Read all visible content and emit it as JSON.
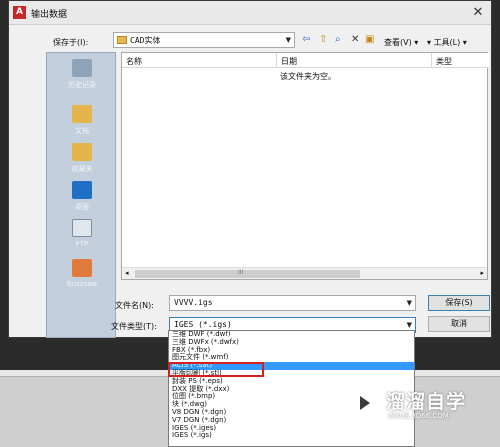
{
  "window": {
    "title": "输出数据",
    "app_icon_letter": "A",
    "close_glyph": "✕"
  },
  "save_in": {
    "label": "保存于(I):",
    "value": "CAD实体"
  },
  "toolbar": {
    "back_glyph": "⇦",
    "up_glyph": "⇧",
    "search_glyph": "⌕",
    "delete_glyph": "✕",
    "newfolder_glyph": "▣",
    "view_label": "查看(V)",
    "tools_label": "工具(L)"
  },
  "places": [
    {
      "name": "history",
      "label": "历史记录",
      "color": "#8ea2b8"
    },
    {
      "name": "documents",
      "label": "文档",
      "color": "#e3b54a"
    },
    {
      "name": "favorites",
      "label": "收藏夹",
      "color": "#e3b54a"
    },
    {
      "name": "desktop",
      "label": "桌面",
      "color": "#1f6fc4"
    },
    {
      "name": "ftp",
      "label": "FTP",
      "color": "#dfe6ee"
    },
    {
      "name": "buzzsaw",
      "label": "Buzzsaw",
      "color": "#e07a3a"
    }
  ],
  "filelist": {
    "col_name": "名称",
    "col_date": "日期",
    "col_type": "类型",
    "empty_text": "该文件夹为空。",
    "scroll_mark": "III"
  },
  "filename": {
    "label": "文件名(N):",
    "value": "VVVV.igs"
  },
  "filetype": {
    "label": "文件类型(T):",
    "value": "IGES (*.igs)"
  },
  "buttons": {
    "save": "保存(S)",
    "cancel": "取消"
  },
  "dropdown_options": [
    "三维 DWF (*.dwf)",
    "三维 DWFx (*.dwfx)",
    "FBX (*.fbx)",
    "图元文件 (*.wmf)",
    "ACIS (*.sat)",
    "平版印刷 (*.stl)",
    "封装 PS (*.eps)",
    "DXX 提取 (*.dxx)",
    "位图 (*.bmp)",
    "块 (*.dwg)",
    "V8 DGN (*.dgn)",
    "V7 DGN (*.dgn)",
    "IGES (*.iges)",
    "IGES (*.igs)"
  ],
  "selected_option_index": 4,
  "watermark": {
    "name": "溜溜自学",
    "url": "ZIXUE.3D66.COM"
  }
}
